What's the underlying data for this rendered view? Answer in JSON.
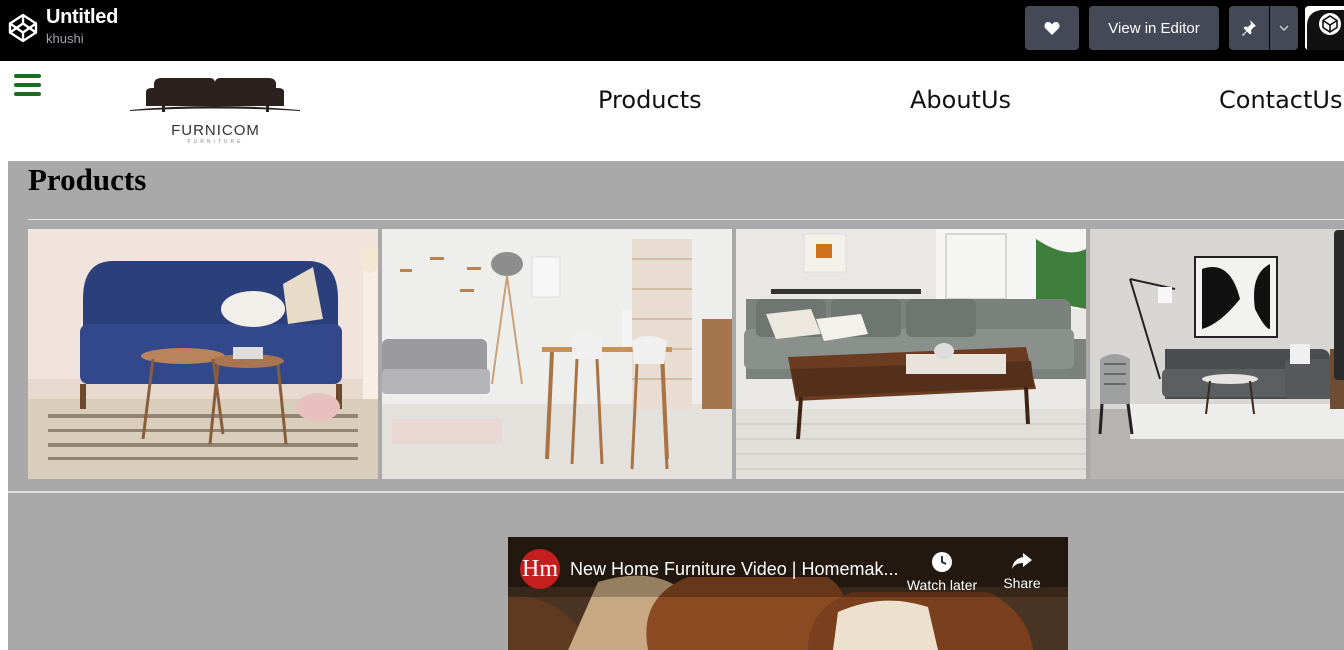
{
  "codepen": {
    "title": "Untitled",
    "author": "khushi",
    "view_in_editor": "View in Editor"
  },
  "nav": {
    "brand_name": "FURNICOM",
    "brand_tagline": "FURNITURE",
    "links": [
      "Products",
      "AboutUs",
      "ContactUs"
    ]
  },
  "main": {
    "heading": "Products",
    "images": [
      "blue sofa living room",
      "grey sofa with dining table",
      "grey sectional with coffee table",
      "dark grey sofa with armchairs"
    ]
  },
  "video": {
    "channel_logo": "Hm",
    "title": "New Home Furniture Video | Homemak...",
    "watch_later": "Watch later",
    "share": "Share"
  },
  "colors": {
    "topbar": "#000000",
    "button": "#444857",
    "content_bg": "#a9a9a9",
    "hamburger": "#1e6b22"
  }
}
